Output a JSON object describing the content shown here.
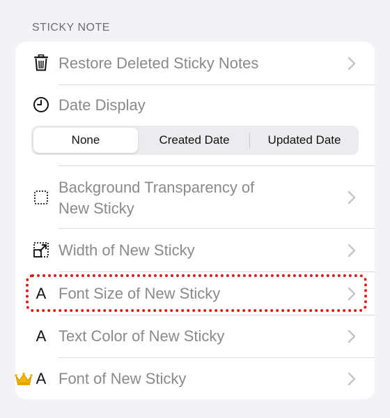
{
  "section": {
    "header": "STICKY NOTE"
  },
  "rows": {
    "restore": {
      "label": "Restore Deleted Sticky Notes",
      "icon": "trash-icon"
    },
    "date_display": {
      "label": "Date Display",
      "icon": "clock-icon"
    },
    "background": {
      "label_line1": "Background Transparency of",
      "label_line2": "New Sticky",
      "icon": "dotted-square-icon"
    },
    "width": {
      "label": "Width of New Sticky",
      "icon": "resize-icon"
    },
    "font_size": {
      "label": "Font Size of New Sticky",
      "icon_text": "A"
    },
    "text_color": {
      "label": "Text Color of New Sticky",
      "icon_text": "A"
    },
    "font": {
      "label": "Font of New Sticky",
      "icon_text": "A",
      "badge": "crown-icon"
    }
  },
  "date_segments": {
    "options": [
      "None",
      "Created Date",
      "Updated Date"
    ],
    "selected": "None"
  },
  "colors": {
    "background": "#f2f2f7",
    "card": "#ffffff",
    "label": "#8a8a8e",
    "highlight": "#e0141e",
    "crown": "#f2b600"
  }
}
